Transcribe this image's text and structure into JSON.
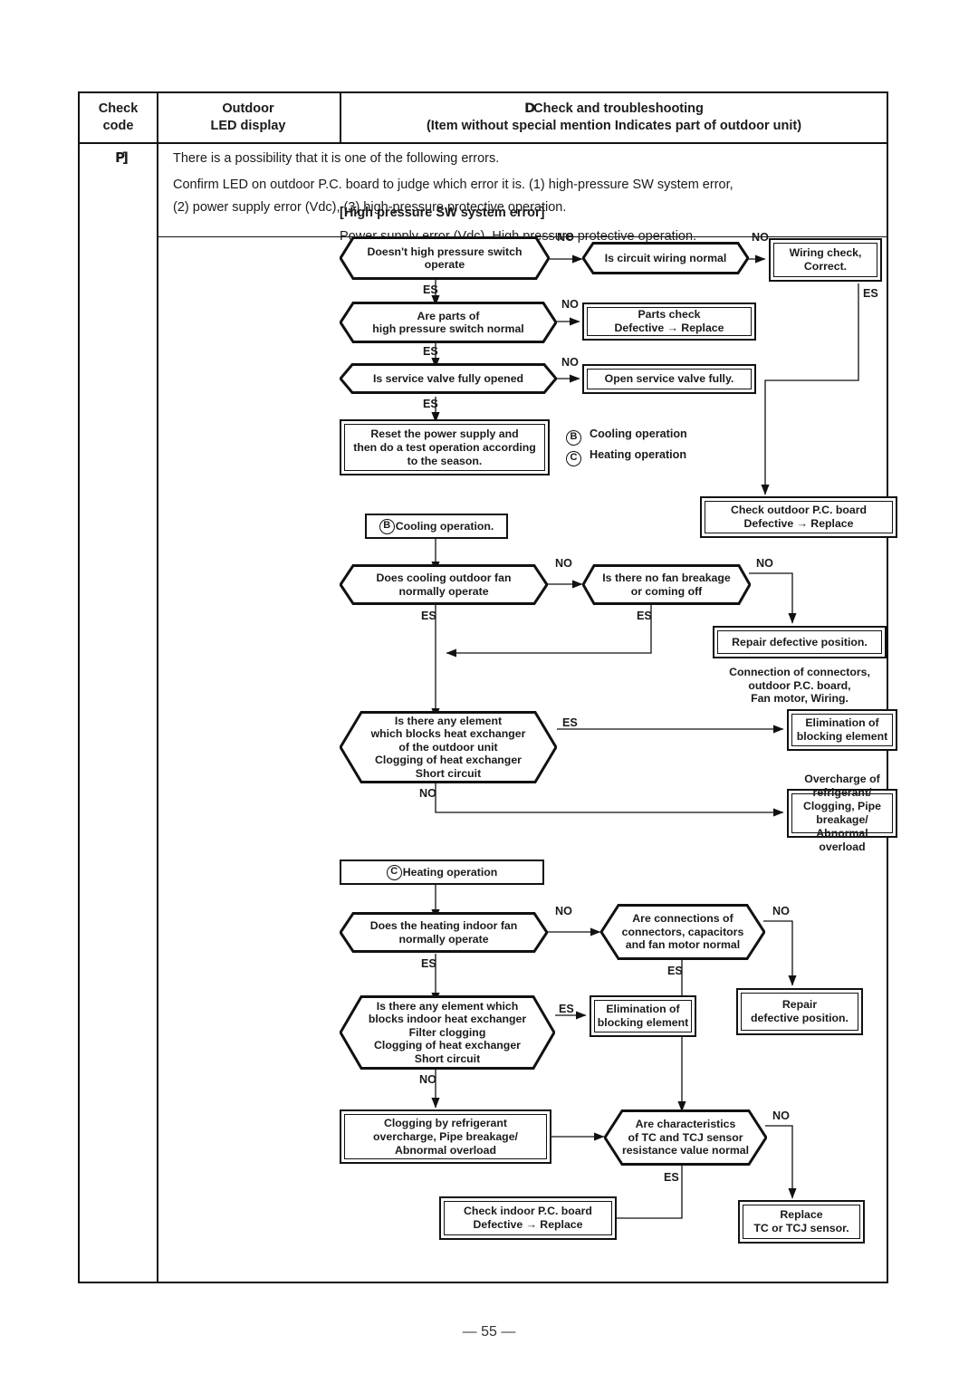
{
  "table": {
    "headers": {
      "check_code": "Check\ncode",
      "check_code_l1": "Check",
      "check_code_l2": "code",
      "outdoor_l1": "Outdoor",
      "outdoor_l2": "LED display",
      "troubleshoot_l1": "Check and troubleshooting",
      "troubleshoot_prefix": "D",
      "troubleshoot_l2": "(Item without special mention Indicates part of outdoor unit)"
    },
    "row": {
      "check_code_value": "P]",
      "intro_line1": "There is a possibility that it is one of the following errors.",
      "intro_line2": "Confirm LED on outdoor P.C. board to judge which error it is.  (1) high-pressure SW system error,",
      "intro_line3": "(2) power supply error (Vdc), (3) high-pressure protective operation."
    }
  },
  "flowchart": {
    "title": "[High pressure SW system error]",
    "subtitle": "Power supply error (Vdc), High pressure protective operation.",
    "nodes": {
      "d1": "Doesn't high pressure switch\noperate",
      "d1_l1": "Doesn't high pressure switch",
      "d1_l2": "operate",
      "d2": "Is circuit wiring normal",
      "b1_l1": "Wiring check,",
      "b1_l2": "Correct.",
      "d3_l1": "Are parts of",
      "d3_l2": "high pressure switch normal",
      "b2_l1": "Parts check",
      "b2_l2": "Defective → Replace",
      "d4": "Is service valve fully opened",
      "b3": "Open service valve fully.",
      "b4_l1": "Reset the power supply and",
      "b4_l2": "then do a test operation according",
      "b4_l3": "to the season.",
      "legend_b": "Cooling operation",
      "legend_c": "Heating operation",
      "b5": "Cooling operation.",
      "b6_l1": "Check outdoor P.C. board",
      "b6_l2": "Defective → Replace",
      "d5_l1": "Does cooling outdoor fan",
      "d5_l2": "normally operate",
      "d6_l1": "Is there no fan breakage",
      "d6_l2": "or coming off",
      "b7": "Repair defective position.",
      "note1_l1": "Connection of connectors,",
      "note1_l2": "outdoor P.C. board,",
      "note1_l3": "Fan motor, Wiring.",
      "d7_l1": "Is there any element",
      "d7_l2": "which blocks heat exchanger",
      "d7_l3": "of the outdoor unit",
      "d7_l4": "Clogging of heat exchanger",
      "d7_l5": "Short circuit",
      "b8_l1": "Elimination of",
      "b8_l2": "blocking element",
      "b9_l1": "Overcharge of refrigerant/",
      "b9_l2": "Clogging, Pipe breakage/",
      "b9_l3": "Abnormal overload",
      "b10": "Heating operation",
      "d8_l1": "Does the heating indoor fan",
      "d8_l2": "normally operate",
      "d9_l1": "Are connections of",
      "d9_l2": "connectors, capacitors",
      "d9_l3": "and fan motor normal",
      "d10_l1": "Is there any element which",
      "d10_l2": "blocks indoor heat exchanger",
      "d10_l3": "Filter clogging",
      "d10_l4": "Clogging of heat exchanger",
      "d10_l5": "Short circuit",
      "b11_l1": "Elimination of",
      "b11_l2": "blocking element",
      "b12_l1": "Repair",
      "b12_l2": "defective position.",
      "b13_l1": "Clogging by refrigerant",
      "b13_l2": "overcharge, Pipe breakage/",
      "b13_l3": "Abnormal overload",
      "d11_l1": "Are characteristics",
      "d11_l2": "of TC and TCJ sensor",
      "d11_l3": "resistance value normal",
      "b14_l1": "Check indoor P.C. board",
      "b14_l2": "Defective → Replace",
      "b15_l1": "Replace",
      "b15_l2": "TC or TCJ sensor."
    },
    "edge_labels": {
      "no": "NO",
      "yes": "YES",
      "yes_rendered": "ES"
    },
    "circle_b": "B",
    "circle_c": "C"
  },
  "page": {
    "footer": "— 55 —"
  },
  "colors": {
    "ink": "#111111",
    "paper": "#ffffff"
  }
}
